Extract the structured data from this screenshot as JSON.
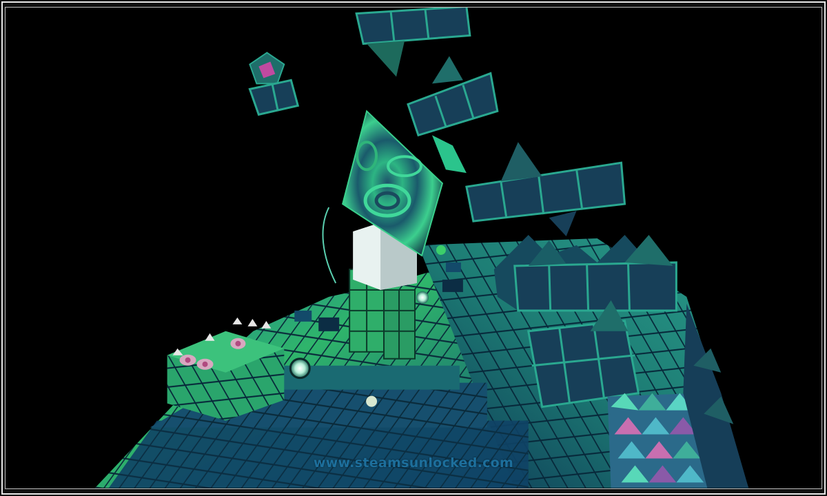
{
  "image": {
    "description_type": "game-screenshot",
    "watermark_text": "www.steamsunlocked.com"
  },
  "palette": {
    "background": "#000000",
    "frame": "#e8e8e8",
    "grid_dark": "#0b3b52",
    "grid_teal": "#1f8a7a",
    "grid_green": "#2fb56b",
    "tile_fill": "#143e55",
    "tile_edge": "#2aa890",
    "accent_pink": "#c86fb0",
    "watermark": "#1d6f9c"
  },
  "icons": {
    "floating_blocks": "cube-cluster-icon",
    "spike": "pyramid-spike-icon",
    "swirl_panel": "swirl-crystal-icon",
    "orb": "glowing-orb-icon",
    "creature": "alien-creature-icon"
  }
}
